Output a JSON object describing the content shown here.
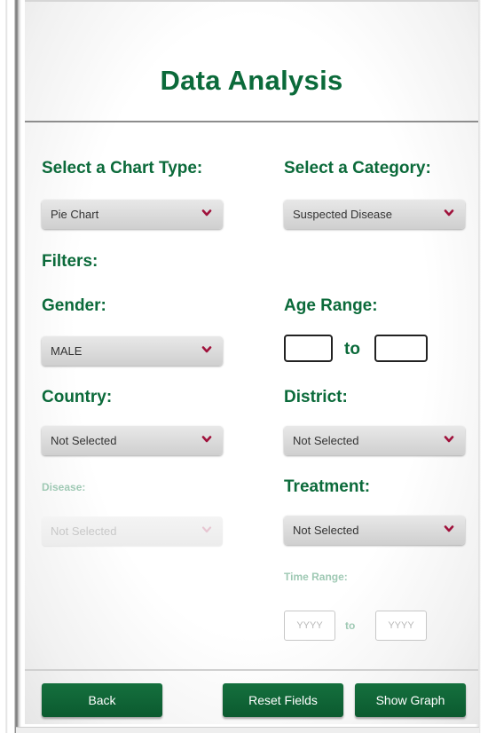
{
  "title": "Data Analysis",
  "chart_type": {
    "label": "Select a Chart Type:",
    "value": "Pie Chart"
  },
  "category": {
    "label": "Select a Category:",
    "value": "Suspected Disease"
  },
  "filters_label": "Filters:",
  "gender": {
    "label": "Gender:",
    "value": "MALE"
  },
  "age_range": {
    "label": "Age Range:",
    "to": "to",
    "from_value": "",
    "to_value": ""
  },
  "country": {
    "label": "Country:",
    "value": "Not Selected"
  },
  "district": {
    "label": "District:",
    "value": "Not Selected"
  },
  "disease": {
    "label": "Disease:",
    "value": "Not Selected"
  },
  "treatment": {
    "label": "Treatment:",
    "value": "Not Selected"
  },
  "time_range": {
    "label": "Time Range:",
    "from_placeholder": "YYYY",
    "to": "to",
    "to_placeholder": "YYYY"
  },
  "buttons": {
    "back": "Back",
    "reset": "Reset Fields",
    "show_graph": "Show Graph"
  },
  "colors": {
    "accent": "#0b6a3a",
    "disabled_text": "#9fc9b4",
    "chevron": "#a0123c"
  }
}
